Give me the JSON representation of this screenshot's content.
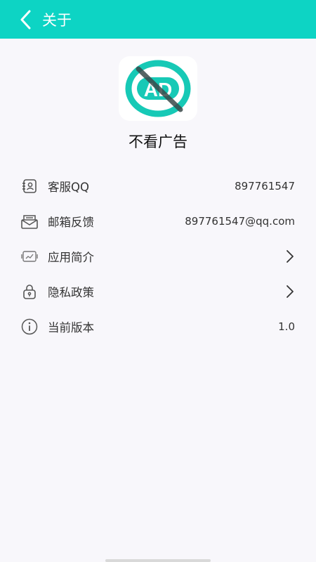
{
  "header": {
    "title": "关于",
    "accent_color": "#0dd4c4"
  },
  "app": {
    "name": "不看广告",
    "logo_text": "AD",
    "logo_icon": "no-ads-icon"
  },
  "list": [
    {
      "label": "客服QQ",
      "value": "897761547",
      "icon": "contact-card-icon"
    },
    {
      "label": "邮箱反馈",
      "value": "897761547@qq.com",
      "icon": "mail-icon"
    },
    {
      "label": "应用简介",
      "value": "",
      "icon": "app-intro-icon",
      "chevron": true
    },
    {
      "label": "隐私政策",
      "value": "",
      "icon": "lock-icon",
      "chevron": true
    },
    {
      "label": "当前版本",
      "value": "1.0",
      "icon": "info-icon"
    }
  ]
}
